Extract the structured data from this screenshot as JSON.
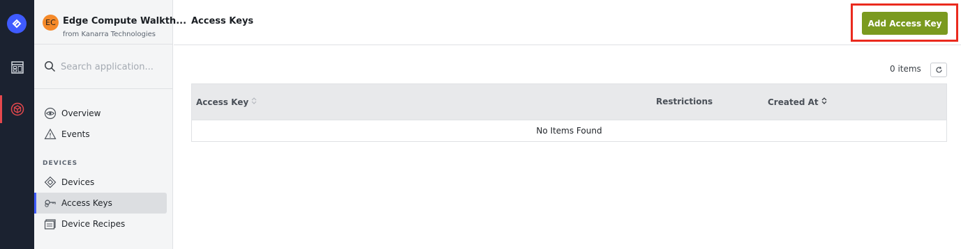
{
  "app": {
    "avatar_initials": "EC",
    "name": "Edge Compute Walkth...",
    "org": "from Kanarra Technologies",
    "avatar_color": "#f58a2a"
  },
  "search": {
    "placeholder": "Search application..."
  },
  "nav": {
    "items": [
      {
        "label": "Overview",
        "icon": "eye-icon"
      },
      {
        "label": "Events",
        "icon": "warning-triangle-icon"
      }
    ],
    "devices_section": "DEVICES",
    "device_items": [
      {
        "label": "Devices",
        "icon": "diamond-icon"
      },
      {
        "label": "Access Keys",
        "icon": "key-icon",
        "active": true
      },
      {
        "label": "Device Recipes",
        "icon": "recipe-icon"
      }
    ]
  },
  "header": {
    "title": "Access Keys",
    "add_button": "Add Access Key"
  },
  "table": {
    "count_label": "0 items",
    "columns": [
      "Access Key",
      "Restrictions",
      "Created At"
    ],
    "empty_message": "No Items Found"
  },
  "colors": {
    "rail_bg": "#1b2230",
    "accent_blue": "#3f5bff",
    "primary_button": "#7a9a1f",
    "highlight_box": "#ea2a1e"
  }
}
